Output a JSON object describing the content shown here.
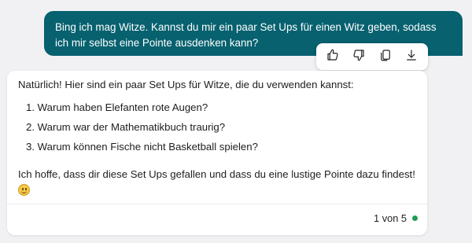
{
  "user_message": {
    "text": "Bing ich mag Witze. Kannst du mir ein paar Set Ups für einen Witz geben, sodass ich mir selbst eine Pointe ausdenken kann?"
  },
  "toolbar": {
    "icons": [
      "thumbs-up-icon",
      "thumbs-down-icon",
      "copy-icon",
      "download-icon"
    ]
  },
  "bot_message": {
    "intro": "Natürlich! Hier sind ein paar Set Ups für Witze, die du verwenden kannst:",
    "items": [
      "1. Warum haben Elefanten rote Augen?",
      "2. Warum war der Mathematikbuch traurig?",
      "3. Warum können Fische nicht Basketball spielen?"
    ],
    "outro": "Ich hoffe, dass dir diese Set Ups gefallen und dass du eine lustige Pointe dazu findest!",
    "emoji": "smiling-face-emoji"
  },
  "footer": {
    "counter": "1 von 5",
    "status_color": "#1f9d55"
  },
  "colors": {
    "user_bubble": "#07616f",
    "background": "#f1f1f3"
  }
}
